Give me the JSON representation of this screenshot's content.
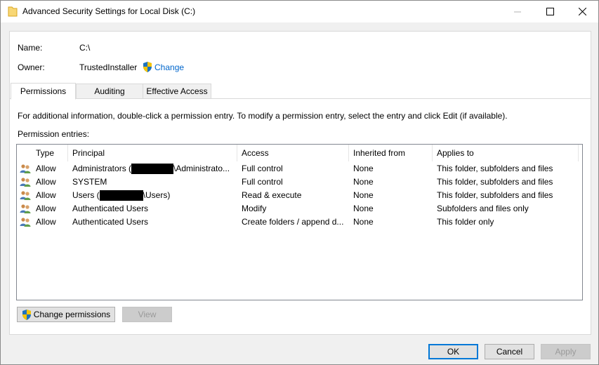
{
  "window": {
    "title": "Advanced Security Settings for Local Disk (C:)",
    "minimize_icon": "minimize-icon",
    "maximize_icon": "maximize-icon",
    "close_icon": "close-icon"
  },
  "details": {
    "name_label": "Name:",
    "name_value": "C:\\",
    "owner_label": "Owner:",
    "owner_value": "TrustedInstaller",
    "owner_change": "Change"
  },
  "tabs": [
    {
      "label": "Permissions",
      "active": true
    },
    {
      "label": "Auditing",
      "active": false
    },
    {
      "label": "Effective Access",
      "active": false
    }
  ],
  "info_text": "For additional information, double-click a permission entry. To modify a permission entry, select the entry and click Edit (if available).",
  "entries_label": "Permission entries:",
  "columns": [
    "Type",
    "Principal",
    "Access",
    "Inherited from",
    "Applies to"
  ],
  "rows": [
    {
      "type": "Allow",
      "principal_pre": "Administrators (",
      "principal_post": "\\Administrato...",
      "redacted": true,
      "access": "Full control",
      "inherited": "None",
      "applies": "This folder, subfolders and files"
    },
    {
      "type": "Allow",
      "principal_pre": "SYSTEM",
      "principal_post": "",
      "redacted": false,
      "access": "Full control",
      "inherited": "None",
      "applies": "This folder, subfolders and files"
    },
    {
      "type": "Allow",
      "principal_pre": "Users (",
      "principal_post": "\\Users)",
      "redacted": true,
      "access": "Read & execute",
      "inherited": "None",
      "applies": "This folder, subfolders and files"
    },
    {
      "type": "Allow",
      "principal_pre": "Authenticated Users",
      "principal_post": "",
      "redacted": false,
      "access": "Modify",
      "inherited": "None",
      "applies": "Subfolders and files only"
    },
    {
      "type": "Allow",
      "principal_pre": "Authenticated Users",
      "principal_post": "",
      "redacted": false,
      "access": "Create folders / append d...",
      "inherited": "None",
      "applies": "This folder only"
    }
  ],
  "buttons": {
    "change_permissions": "Change permissions",
    "view": "View",
    "ok": "OK",
    "cancel": "Cancel",
    "apply": "Apply"
  },
  "colors": {
    "link": "#0066cc",
    "accent": "#0078d7"
  }
}
